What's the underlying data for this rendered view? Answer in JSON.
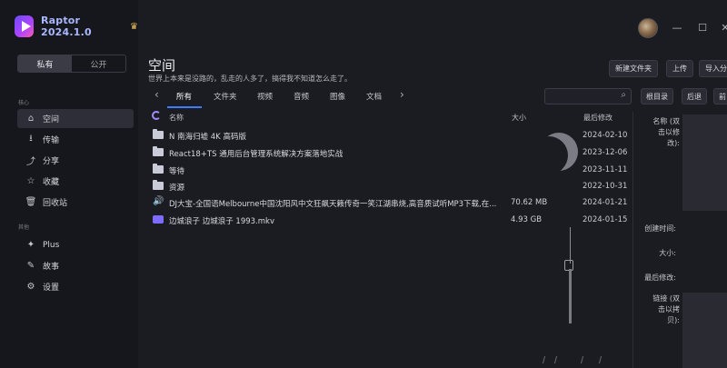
{
  "app": {
    "title": "Raptor 2024.1.0"
  },
  "scope": {
    "private": "私有",
    "public": "公开"
  },
  "sidebar": {
    "section_main": "核心",
    "section_other": "其他",
    "items": [
      {
        "label": "空间",
        "icon": "home-icon"
      },
      {
        "label": "传输",
        "icon": "download-icon"
      },
      {
        "label": "分享",
        "icon": "share-icon"
      },
      {
        "label": "收藏",
        "icon": "star-icon"
      },
      {
        "label": "回收站",
        "icon": "trash-icon"
      }
    ],
    "other_items": [
      {
        "label": "Plus",
        "icon": "wand-icon"
      },
      {
        "label": "故事",
        "icon": "feather-icon"
      },
      {
        "label": "设置",
        "icon": "gear-icon"
      }
    ]
  },
  "header": {
    "title": "空间",
    "subtitle": "世界上本来是没路的，乱走的人多了，搞得我不知道怎么走了。",
    "new_folder": "新建文件夹",
    "upload": "上传",
    "import": "导入分"
  },
  "tabs": [
    "所有",
    "文件夹",
    "视频",
    "音频",
    "图像",
    "文档"
  ],
  "toolbar": {
    "root": "根目录",
    "back": "后退",
    "next": "前"
  },
  "columns": {
    "name": "名称",
    "size": "大小",
    "modified": "最后修改"
  },
  "files": [
    {
      "name": "N 南海归墟 4K 高码版",
      "size": "",
      "date": "2024-02-10",
      "kind": "folder"
    },
    {
      "name": "React18+TS 通用后台管理系统解决方案落地实战",
      "size": "",
      "date": "2023-12-06",
      "kind": "folder"
    },
    {
      "name": "等待",
      "size": "",
      "date": "2023-11-11",
      "kind": "folder"
    },
    {
      "name": "资源",
      "size": "",
      "date": "2022-10-31",
      "kind": "folder"
    },
    {
      "name": "DJ大宝-全国语Melbourne中国沈阳风中文狂飙天籁传奇一笑江湖串烧,高音质试听MP3下载,在...",
      "size": "70.62 MB",
      "date": "2024-01-21",
      "kind": "audio"
    },
    {
      "name": "边城浪子 边城浪子 1993.mkv",
      "size": "4.93 GB",
      "date": "2024-01-15",
      "kind": "video"
    }
  ],
  "details": {
    "name_label": "名称 (双\n击以修\n改):",
    "created_label": "创建时间:",
    "size_label": "大小:",
    "modified_label": "最后修改:",
    "link_label": "链接 (双\n击以拷\n贝):"
  },
  "colors": {
    "accent": "#3d7cff",
    "brand": "#a9b7ff",
    "background": "#1b1c22",
    "sidebar": "#16171c"
  }
}
